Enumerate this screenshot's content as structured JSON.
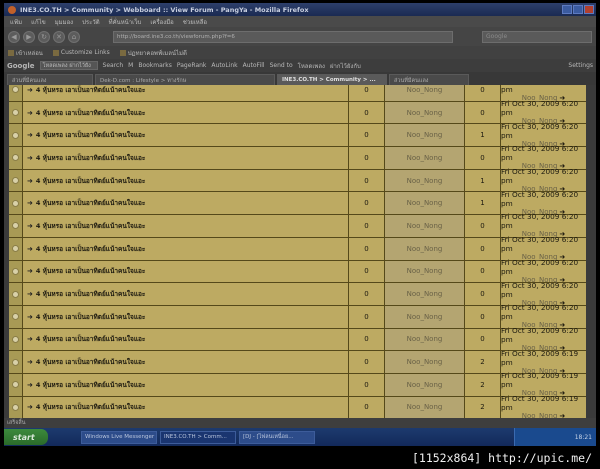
{
  "window": {
    "title": "INE3.CO.TH > Community > Webboard :: View Forum - PangYa - Mozilla Firefox"
  },
  "menu": [
    "แฟ้ม",
    "แก้ไข",
    "มุมมอง",
    "ประวัติ",
    "ที่คั่นหน้าเว็บ",
    "เครื่องมือ",
    "ช่วยเหลือ"
  ],
  "nav": {
    "url": "http://board.ine3.co.th/viewforum.php?f=6",
    "search_placeholder": "Google"
  },
  "bookmarks": [
    "เข้าเหล่อน",
    "Customize Links",
    "ปฏทยาคอพฟ์เมลน์ไม่ดี"
  ],
  "google_toolbar": {
    "logo": "Google",
    "search_value": "โหลดเพลง ฝากไว้ยัง",
    "items": [
      "Search",
      "M",
      "Bookmarks",
      "PageRank",
      "AutoLink",
      "AutoFill",
      "Send to",
      "โหลดเพลง",
      "ฝากไว้ยังกับ"
    ],
    "settings": "Settings"
  },
  "tabs": [
    {
      "label": "ส่วนที่มีคนแลง",
      "active": false
    },
    {
      "label": "Dek-D.com : Lifestyle > ทางรักษ",
      "active": false
    },
    {
      "label": "INE3.CO.TH > Community > ...",
      "active": true
    },
    {
      "label": "ส่วนที่มีคนแลง",
      "active": false
    }
  ],
  "rows": [
    {
      "topic": "4 หุ้นหรอ เอาเป็นอาทิตย์แน้าคนใจแอะ",
      "replies": "0",
      "author": "Noo_Nong",
      "views": "0",
      "last_date": "Fri Oct 30, 2009 6:20 pm",
      "last_by": "Noo_Nong"
    },
    {
      "topic": "4 หุ้นหรอ เอาเป็นอาทิตย์แน้าคนใจแอะ",
      "replies": "0",
      "author": "Noo_Nong",
      "views": "0",
      "last_date": "Fri Oct 30, 2009 6:20 pm",
      "last_by": "Noo_Nong"
    },
    {
      "topic": "4 หุ้นหรอ เอาเป็นอาทิตย์แน้าคนใจแอะ",
      "replies": "0",
      "author": "Noo_Nong",
      "views": "1",
      "last_date": "Fri Oct 30, 2009 6:20 pm",
      "last_by": "Noo_Nong"
    },
    {
      "topic": "4 หุ้นหรอ เอาเป็นอาทิตย์แน้าคนใจแอะ",
      "replies": "0",
      "author": "Noo_Nong",
      "views": "0",
      "last_date": "Fri Oct 30, 2009 6:20 pm",
      "last_by": "Noo_Nong"
    },
    {
      "topic": "4 หุ้นหรอ เอาเป็นอาทิตย์แน้าคนใจแอะ",
      "replies": "0",
      "author": "Noo_Nong",
      "views": "1",
      "last_date": "Fri Oct 30, 2009 6:20 pm",
      "last_by": "Noo_Nong"
    },
    {
      "topic": "4 หุ้นหรอ เอาเป็นอาทิตย์แน้าคนใจแอะ",
      "replies": "0",
      "author": "Noo_Nong",
      "views": "1",
      "last_date": "Fri Oct 30, 2009 6:20 pm",
      "last_by": "Noo_Nong"
    },
    {
      "topic": "4 หุ้นหรอ เอาเป็นอาทิตย์แน้าคนใจแอะ",
      "replies": "0",
      "author": "Noo_Nong",
      "views": "0",
      "last_date": "Fri Oct 30, 2009 6:20 pm",
      "last_by": "Noo_Nong"
    },
    {
      "topic": "4 หุ้นหรอ เอาเป็นอาทิตย์แน้าคนใจแอะ",
      "replies": "0",
      "author": "Noo_Nong",
      "views": "0",
      "last_date": "Fri Oct 30, 2009 6:20 pm",
      "last_by": "Noo_Nong"
    },
    {
      "topic": "4 หุ้นหรอ เอาเป็นอาทิตย์แน้าคนใจแอะ",
      "replies": "0",
      "author": "Noo_Nong",
      "views": "0",
      "last_date": "Fri Oct 30, 2009 6:20 pm",
      "last_by": "Noo_Nong"
    },
    {
      "topic": "4 หุ้นหรอ เอาเป็นอาทิตย์แน้าคนใจแอะ",
      "replies": "0",
      "author": "Noo_Nong",
      "views": "0",
      "last_date": "Fri Oct 30, 2009 6:20 pm",
      "last_by": "Noo_Nong"
    },
    {
      "topic": "4 หุ้นหรอ เอาเป็นอาทิตย์แน้าคนใจแอะ",
      "replies": "0",
      "author": "Noo_Nong",
      "views": "0",
      "last_date": "Fri Oct 30, 2009 6:20 pm",
      "last_by": "Noo_Nong"
    },
    {
      "topic": "4 หุ้นหรอ เอาเป็นอาทิตย์แน้าคนใจแอะ",
      "replies": "0",
      "author": "Noo_Nong",
      "views": "0",
      "last_date": "Fri Oct 30, 2009 6:20 pm",
      "last_by": "Noo_Nong"
    },
    {
      "topic": "4 หุ้นหรอ เอาเป็นอาทิตย์แน้าคนใจแอะ",
      "replies": "0",
      "author": "Noo_Nong",
      "views": "2",
      "last_date": "Fri Oct 30, 2009 6:19 pm",
      "last_by": "Noo_Nong"
    },
    {
      "topic": "4 หุ้นหรอ เอาเป็นอาทิตย์แน้าคนใจแอะ",
      "replies": "0",
      "author": "Noo_Nong",
      "views": "2",
      "last_date": "Fri Oct 30, 2009 6:19 pm",
      "last_by": "Noo_Nong"
    },
    {
      "topic": "4 หุ้นหรอ เอาเป็นอาทิตย์แน้าคนใจแอะ",
      "replies": "0",
      "author": "Noo_Nong",
      "views": "2",
      "last_date": "Fri Oct 30, 2009 6:19 pm",
      "last_by": "Noo_Nong"
    }
  ],
  "status": "เสร็จสิ้น",
  "taskbar": {
    "start": "start",
    "tasks": [
      {
        "label": "Windows Live Messenger",
        "active": false
      },
      {
        "label": "INE3.CO.TH > Comm...",
        "active": true
      },
      {
        "label": "[DJ - [ไฟลนเหนื่อย...",
        "active": false
      }
    ],
    "clock": "18:21"
  },
  "caption": "[1152x864] http://upic.me/"
}
